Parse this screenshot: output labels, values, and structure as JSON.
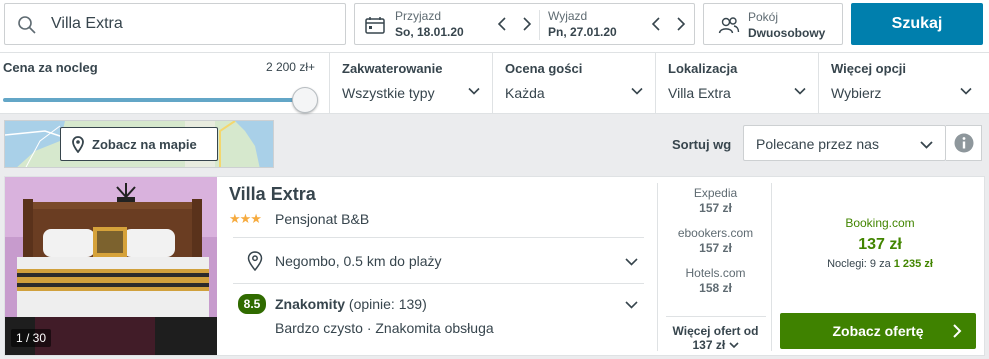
{
  "search": {
    "query": "Villa Extra"
  },
  "dates": {
    "checkin_label": "Przyjazd",
    "checkin_value": "So, 18.01.20",
    "checkout_label": "Wyjazd",
    "checkout_value": "Pn, 27.01.20"
  },
  "rooms": {
    "label": "Pokój",
    "value": "Dwuosobowy"
  },
  "search_button": "Szukaj",
  "filters": {
    "price_title": "Cena za nocleg",
    "price_max": "2 200 zł+",
    "price_level": 1.0,
    "items": [
      {
        "title": "Zakwaterowanie",
        "value": "Wszystkie typy"
      },
      {
        "title": "Ocena gości",
        "value": "Każda"
      },
      {
        "title": "Lokalizacja",
        "value": "Villa Extra"
      },
      {
        "title": "Więcej opcji",
        "value": "Wybierz"
      }
    ]
  },
  "map": {
    "button_label": "Zobacz na mapie"
  },
  "sort": {
    "label": "Sortuj wg",
    "value": "Polecane przez nas"
  },
  "hotel": {
    "name": "Villa Extra",
    "stars": "★★★",
    "type": "Pensjonat B&B",
    "photo_counter": "1 / 30",
    "location": "Negombo, 0.5 km do plaży",
    "rating_score": "8.5",
    "rating_word": "Znakomity",
    "rating_count": "(opinie: 139)",
    "rating_summary": "Bardzo czysto · Znakomita obsługa"
  },
  "alt_prices": [
    {
      "provider": "Expedia",
      "price": "157 zł"
    },
    {
      "provider": "ebookers.com",
      "price": "157 zł"
    },
    {
      "provider": "Hotels.com",
      "price": "158 zł"
    }
  ],
  "more_offers": {
    "label": "Więcej ofert od",
    "price": "137 zł"
  },
  "best_offer": {
    "provider": "Booking.com",
    "price": "137 zł",
    "nights_text": "Noclegi: 9 za",
    "total": "1 235 zł",
    "button_label": "Zobacz ofertę"
  },
  "colors": {
    "search_button": "#007fad",
    "deal_button": "#3f8200",
    "rating_badge": "#306b00",
    "stars": "#f6ab3f"
  }
}
